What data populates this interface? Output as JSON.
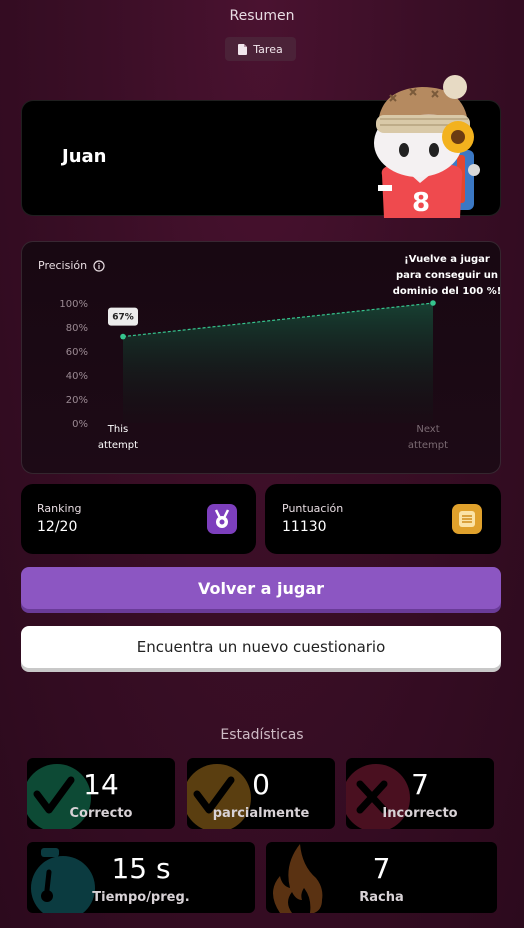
{
  "header": {
    "title": "Resumen",
    "tag_label": "Tarea",
    "tag_icon": "document-icon"
  },
  "player": {
    "name": "Juan",
    "avatar_icon": "monster-avatar"
  },
  "accuracy_chart": {
    "label": "Precisión",
    "info_icon": "info-icon",
    "callout": [
      "¡Vuelve a jugar",
      "para conseguir un",
      "dominio del 100 %!"
    ],
    "current_badge": "67%",
    "chart_data": {
      "type": "area",
      "categories": [
        "This attempt",
        "Next attempt"
      ],
      "tick_lines": [
        [
          "This",
          "attempt"
        ],
        [
          "Next",
          "attempt"
        ]
      ],
      "values": [
        72,
        100
      ],
      "ylim": [
        0,
        100
      ],
      "y_ticks": [
        "0%",
        "20%",
        "40%",
        "60%",
        "80%",
        "100%"
      ],
      "colors": {
        "line": "#36c48e",
        "fill": "#143d30"
      }
    }
  },
  "ranking": {
    "label": "Ranking",
    "value": "12/20",
    "icon": "medal-icon",
    "color": "#7d3fbd"
  },
  "score": {
    "label": "Puntuación",
    "value": "11130",
    "icon": "coins-icon",
    "color": "#e0a12c"
  },
  "actions": {
    "play_again": "Volver a jugar",
    "find_quiz": "Encuentra un nuevo cuestionario"
  },
  "stats": {
    "title": "Estadísticas",
    "tiles": [
      {
        "value": "14",
        "label": "Correcto",
        "icon": "check-icon",
        "color": "#0d4a35"
      },
      {
        "value": "0",
        "label": "parcialmente",
        "icon": "check-icon",
        "color": "#5a3e10"
      },
      {
        "value": "7",
        "label": "Incorrecto",
        "icon": "x-icon",
        "color": "#4a1020"
      },
      {
        "value": "15 s",
        "label": "Tiempo/preg.",
        "icon": "stopwatch-icon",
        "color": "#0b3b40"
      },
      {
        "value": "7",
        "label": "Racha",
        "icon": "flame-icon",
        "color": "#5a3212"
      }
    ]
  }
}
